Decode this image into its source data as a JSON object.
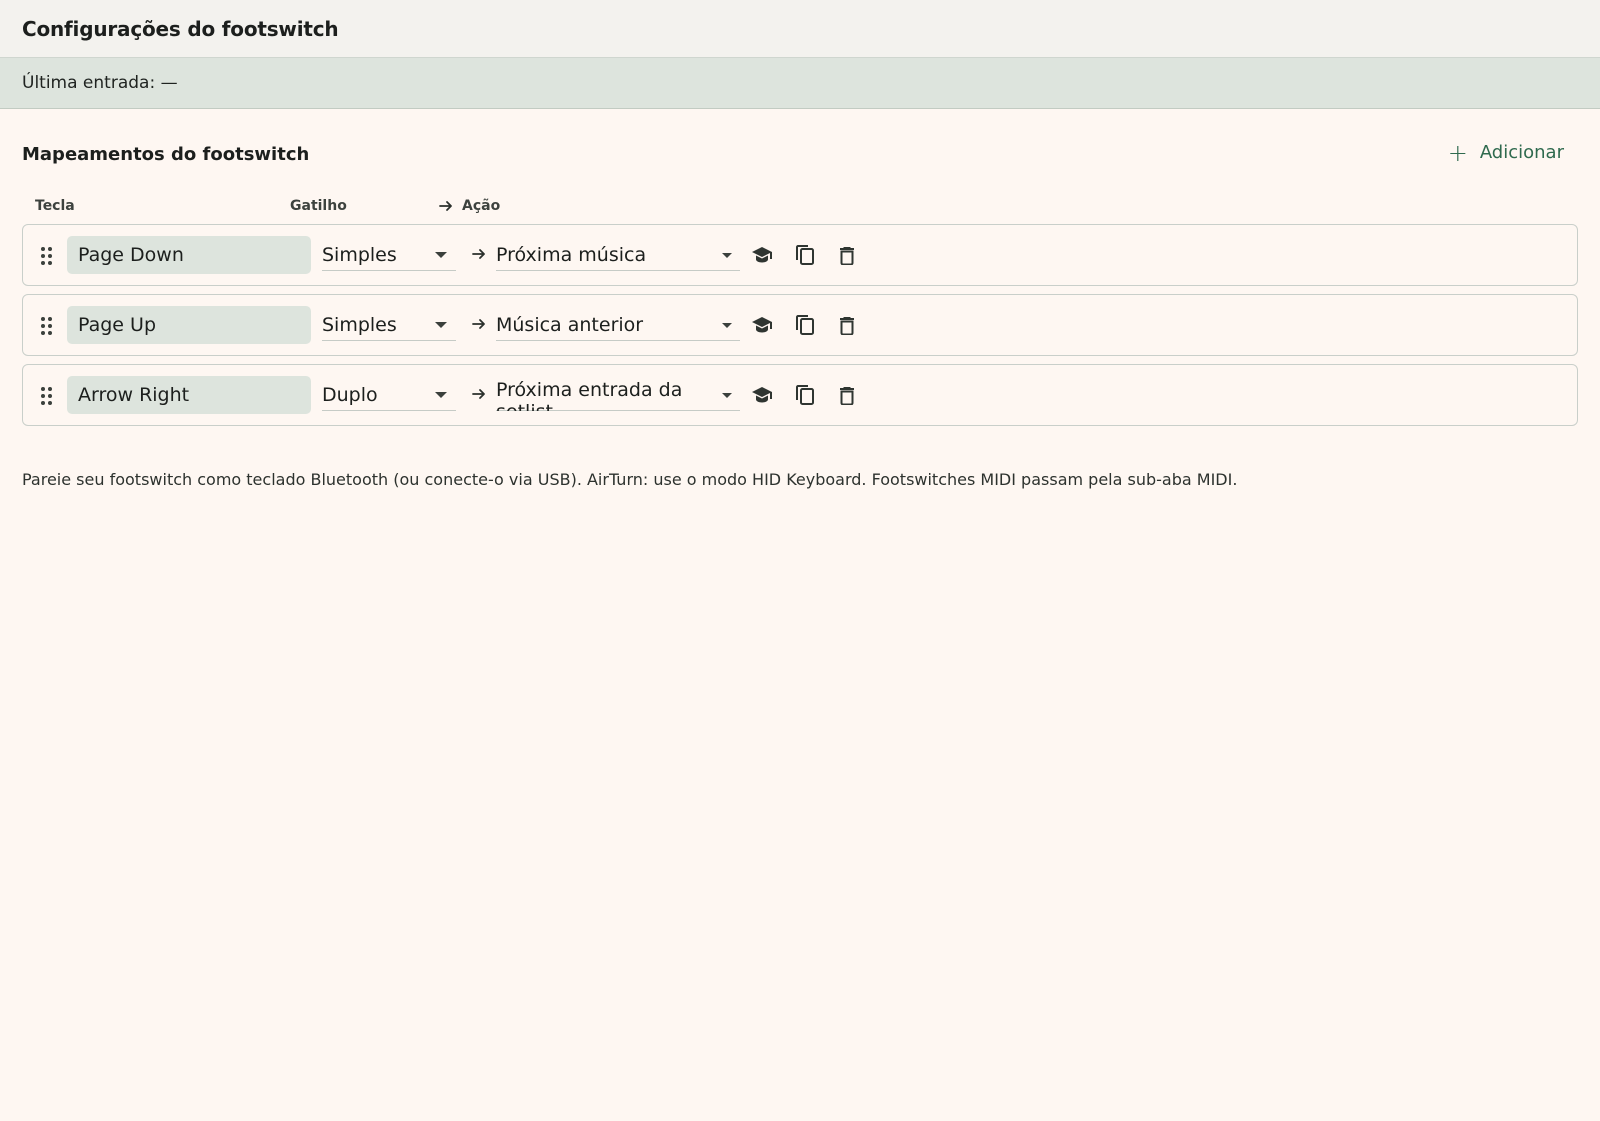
{
  "header": {
    "title": "Configurações do footswitch"
  },
  "status": {
    "last_input": "Última entrada: —"
  },
  "section": {
    "title": "Mapeamentos do footswitch",
    "add_label": "Adicionar"
  },
  "columns": {
    "key": "Tecla",
    "trigger": "Gatilho",
    "action": "Ação"
  },
  "mappings": [
    {
      "key": "Page Down",
      "trigger": "Simples",
      "action": "Próxima música"
    },
    {
      "key": "Page Up",
      "trigger": "Simples",
      "action": "Música anterior"
    },
    {
      "key": "Arrow Right",
      "trigger": "Duplo",
      "action": "Próxima entrada da setlist"
    }
  ],
  "hint": "Pareie seu footswitch como teclado Bluetooth (ou conecte-o via USB). AirTurn: use o modo HID Keyboard. Footswitches MIDI passam pela sub-aba MIDI.",
  "icons": {
    "drag": "drag-handle-icon",
    "arrow": "arrow-right-icon",
    "learn": "graduation-cap-icon",
    "duplicate": "copy-icon",
    "delete": "trash-icon",
    "add": "plus-icon"
  },
  "colors": {
    "accent": "#2f6a4e",
    "header_bg": "#f3f2ee",
    "status_bg": "#dde4dd",
    "page_bg": "#fef7f2"
  }
}
